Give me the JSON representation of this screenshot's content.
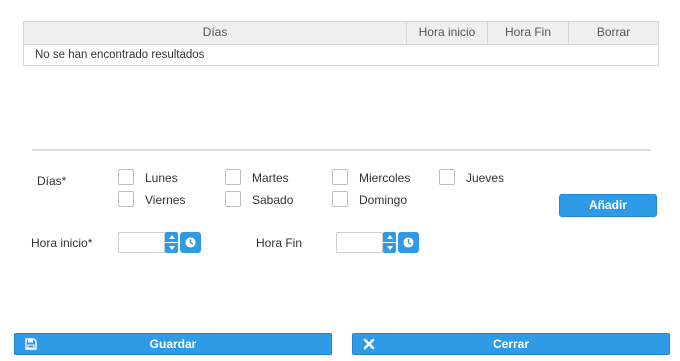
{
  "grid": {
    "columns": [
      "Días",
      "Hora inicio",
      "Hora Fin",
      "Borrar"
    ],
    "empty_message": "No se han encontrado resultados"
  },
  "form": {
    "dias_label": "Días*",
    "days": [
      "Lunes",
      "Martes",
      "Miercoles",
      "Jueves",
      "Viernes",
      "Sabado",
      "Domingo"
    ],
    "add_label": "Añadir",
    "hora_inicio_label": "Hora inicio*",
    "hora_fin_label": "Hora Fin",
    "hora_inicio_value": "",
    "hora_fin_value": ""
  },
  "footer": {
    "save_label": "Guardar",
    "close_label": "Cerrar"
  },
  "colors": {
    "accent": "#2f9be6",
    "header_bg": "#efefef",
    "border": "#d5d5d5"
  },
  "icons": {
    "save": "floppy-disk-icon",
    "close": "x-icon",
    "clock": "clock-icon"
  }
}
